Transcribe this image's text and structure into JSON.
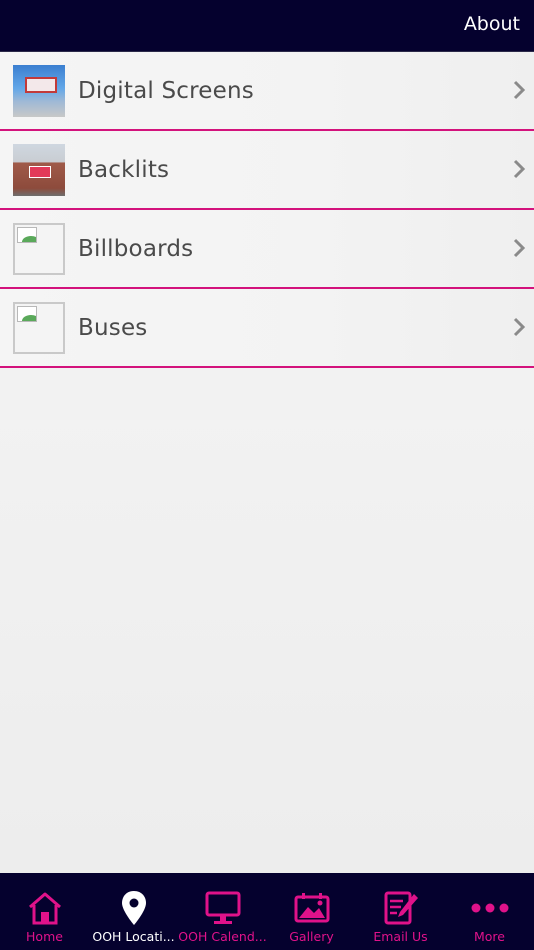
{
  "header": {
    "about_label": "About"
  },
  "list": {
    "items": [
      {
        "label": "Digital Screens",
        "thumbnail": "digital-screen-photo"
      },
      {
        "label": "Backlits",
        "thumbnail": "backlit-photo"
      },
      {
        "label": "Billboards",
        "thumbnail": "broken-image"
      },
      {
        "label": "Buses",
        "thumbnail": "broken-image"
      }
    ]
  },
  "tabbar": {
    "tabs": [
      {
        "label": "Home",
        "icon": "home-icon",
        "active": false
      },
      {
        "label": "OOH Locati...",
        "icon": "location-pin-icon",
        "active": true
      },
      {
        "label": "OOH Calend...",
        "icon": "monitor-icon",
        "active": false
      },
      {
        "label": "Gallery",
        "icon": "gallery-icon",
        "active": false
      },
      {
        "label": "Email Us",
        "icon": "edit-note-icon",
        "active": false
      },
      {
        "label": "More",
        "icon": "more-dots-icon",
        "active": false
      }
    ]
  },
  "colors": {
    "header_bg": "#05012e",
    "accent": "#e0128a",
    "row_divider": "#d3127c",
    "label_text": "#4a4a4a",
    "active_tab": "#ffffff"
  }
}
